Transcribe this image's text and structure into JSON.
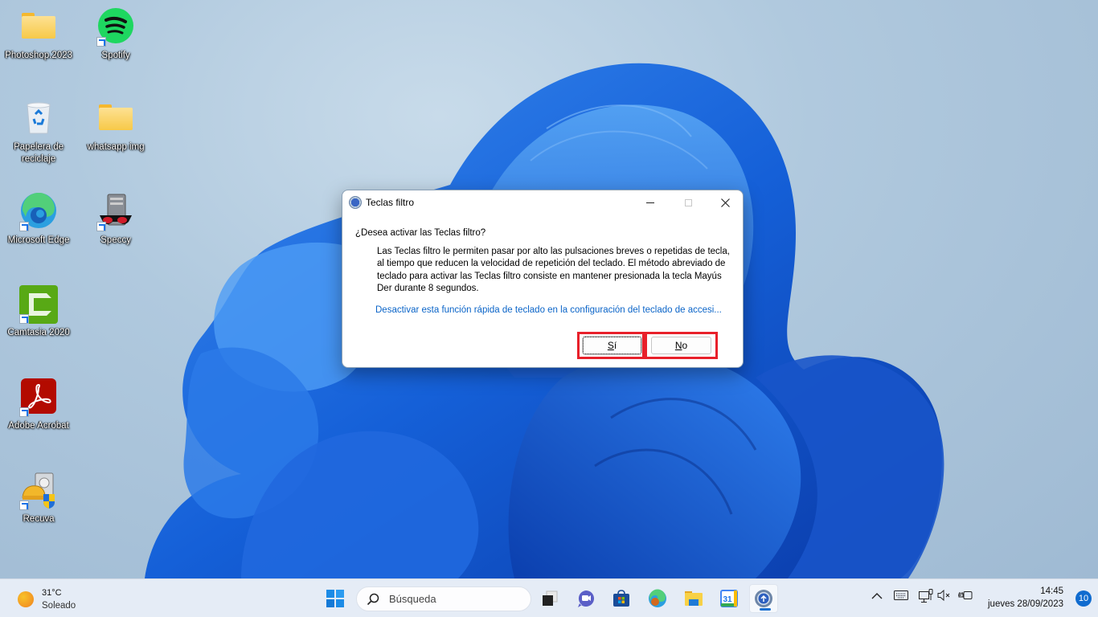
{
  "desktop": {
    "icons": [
      {
        "label": "Photoshop.2023",
        "icon": "folder-icon"
      },
      {
        "label": "Spotify",
        "icon": "spotify-icon"
      },
      {
        "label": "Papelera de reciclaje",
        "icon": "recycle-bin-icon"
      },
      {
        "label": "whatsapp img",
        "icon": "folder-icon"
      },
      {
        "label": "Microsoft Edge",
        "icon": "edge-icon"
      },
      {
        "label": "Speccy",
        "icon": "speccy-icon"
      },
      {
        "label": "Camtasia 2020",
        "icon": "camtasia-icon"
      },
      {
        "label": "Adobe Acrobat",
        "icon": "acrobat-icon"
      },
      {
        "label": "Recuva",
        "icon": "recuva-icon"
      }
    ]
  },
  "dialog": {
    "title": "Teclas filtro",
    "title_icon": "accessibility-icon",
    "question": "¿Desea activar las Teclas filtro?",
    "description": "Las Teclas filtro le permiten pasar por alto las pulsaciones breves o repetidas de tecla, al tiempo que reducen la velocidad de repetición del teclado. El método abreviado de teclado para activar las Teclas filtro consiste en mantener presionada la tecla Mayús Der durante 8 segundos.",
    "link": "Desactivar esta función rápida de teclado en la configuración del teclado de accesi...",
    "yes_label_access": "S",
    "yes_label_rest": "í",
    "no_label_access": "N",
    "no_label_rest": "o",
    "highlight_color": "#e8202a",
    "link_color": "#0a64c8"
  },
  "taskbar": {
    "weather": {
      "temperature": "31°C",
      "condition": "Soleado",
      "icon": "sun-icon"
    },
    "search_placeholder": "Búsqueda",
    "apps": [
      {
        "name": "start",
        "icon": "windows-start-icon"
      },
      {
        "name": "task-view",
        "icon": "task-view-icon"
      },
      {
        "name": "meet",
        "icon": "meet-chat-icon"
      },
      {
        "name": "store",
        "icon": "microsoft-store-icon"
      },
      {
        "name": "edge",
        "icon": "edge-icon"
      },
      {
        "name": "file-explorer",
        "icon": "folder-icon"
      },
      {
        "name": "calendar",
        "icon": "calendar-icon",
        "badge_text": "31"
      },
      {
        "name": "accessibility",
        "icon": "accessibility-icon",
        "active": true
      }
    ],
    "tray": {
      "time": "14:45",
      "date": "jueves 28/09/2023",
      "notifications": "10"
    }
  }
}
